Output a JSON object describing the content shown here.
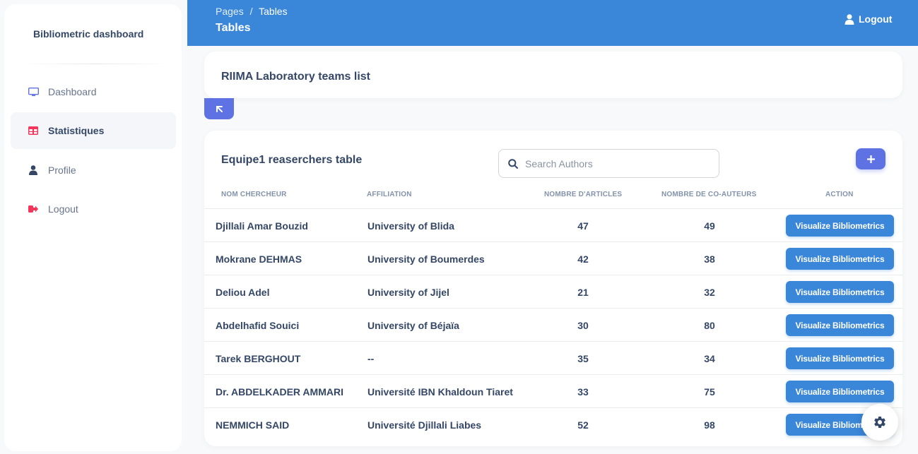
{
  "sidebar": {
    "brand": "Bibliometric dashboard",
    "items": [
      {
        "label": "Dashboard",
        "icon": "monitor-icon"
      },
      {
        "label": "Statistiques",
        "icon": "table-icon",
        "active": true
      },
      {
        "label": "Profile",
        "icon": "user-icon"
      },
      {
        "label": "Logout",
        "icon": "sign-out-icon"
      }
    ]
  },
  "header": {
    "breadcrumb_root": "Pages",
    "breadcrumb_sep": "/",
    "breadcrumb_current": "Tables",
    "title": "Tables",
    "logout_label": "Logout"
  },
  "teams_card": {
    "title": "RIIMA Laboratory teams list"
  },
  "researchers": {
    "title": "Equipe1 reaserchers table",
    "search_placeholder": "Search Authors",
    "add_label": "+",
    "columns": [
      "NOM CHERCHEUR",
      "AFFILIATION",
      "NOMBRE D'ARTICLES",
      "NOMBRE DE CO-AUTEURS",
      "ACTION"
    ],
    "action_label": "Visualize Bibliometrics",
    "rows": [
      {
        "name": "Djillali Amar Bouzid",
        "affiliation": "University of Blida",
        "articles": "47",
        "coauthors": "49"
      },
      {
        "name": "Mokrane DEHMAS",
        "affiliation": "University of Boumerdes",
        "articles": "42",
        "coauthors": "38"
      },
      {
        "name": "Deliou Adel",
        "affiliation": "University of Jijel",
        "articles": "21",
        "coauthors": "32"
      },
      {
        "name": "Abdelhafid Souici",
        "affiliation": "University of Béjaïa",
        "articles": "30",
        "coauthors": "80"
      },
      {
        "name": "Tarek BERGHOUT",
        "affiliation": "--",
        "articles": "35",
        "coauthors": "34"
      },
      {
        "name": "Dr. ABDELKADER AMMARI",
        "affiliation": "Université IBN Khaldoun Tiaret",
        "articles": "33",
        "coauthors": "75"
      },
      {
        "name": "NEMMICH SAID",
        "affiliation": "Université Djillali Liabes",
        "articles": "52",
        "coauthors": "98"
      }
    ]
  },
  "colors": {
    "header": "#3a87d9",
    "accent": "#5e72e4",
    "text": "#344767",
    "muted": "#8392ab"
  }
}
